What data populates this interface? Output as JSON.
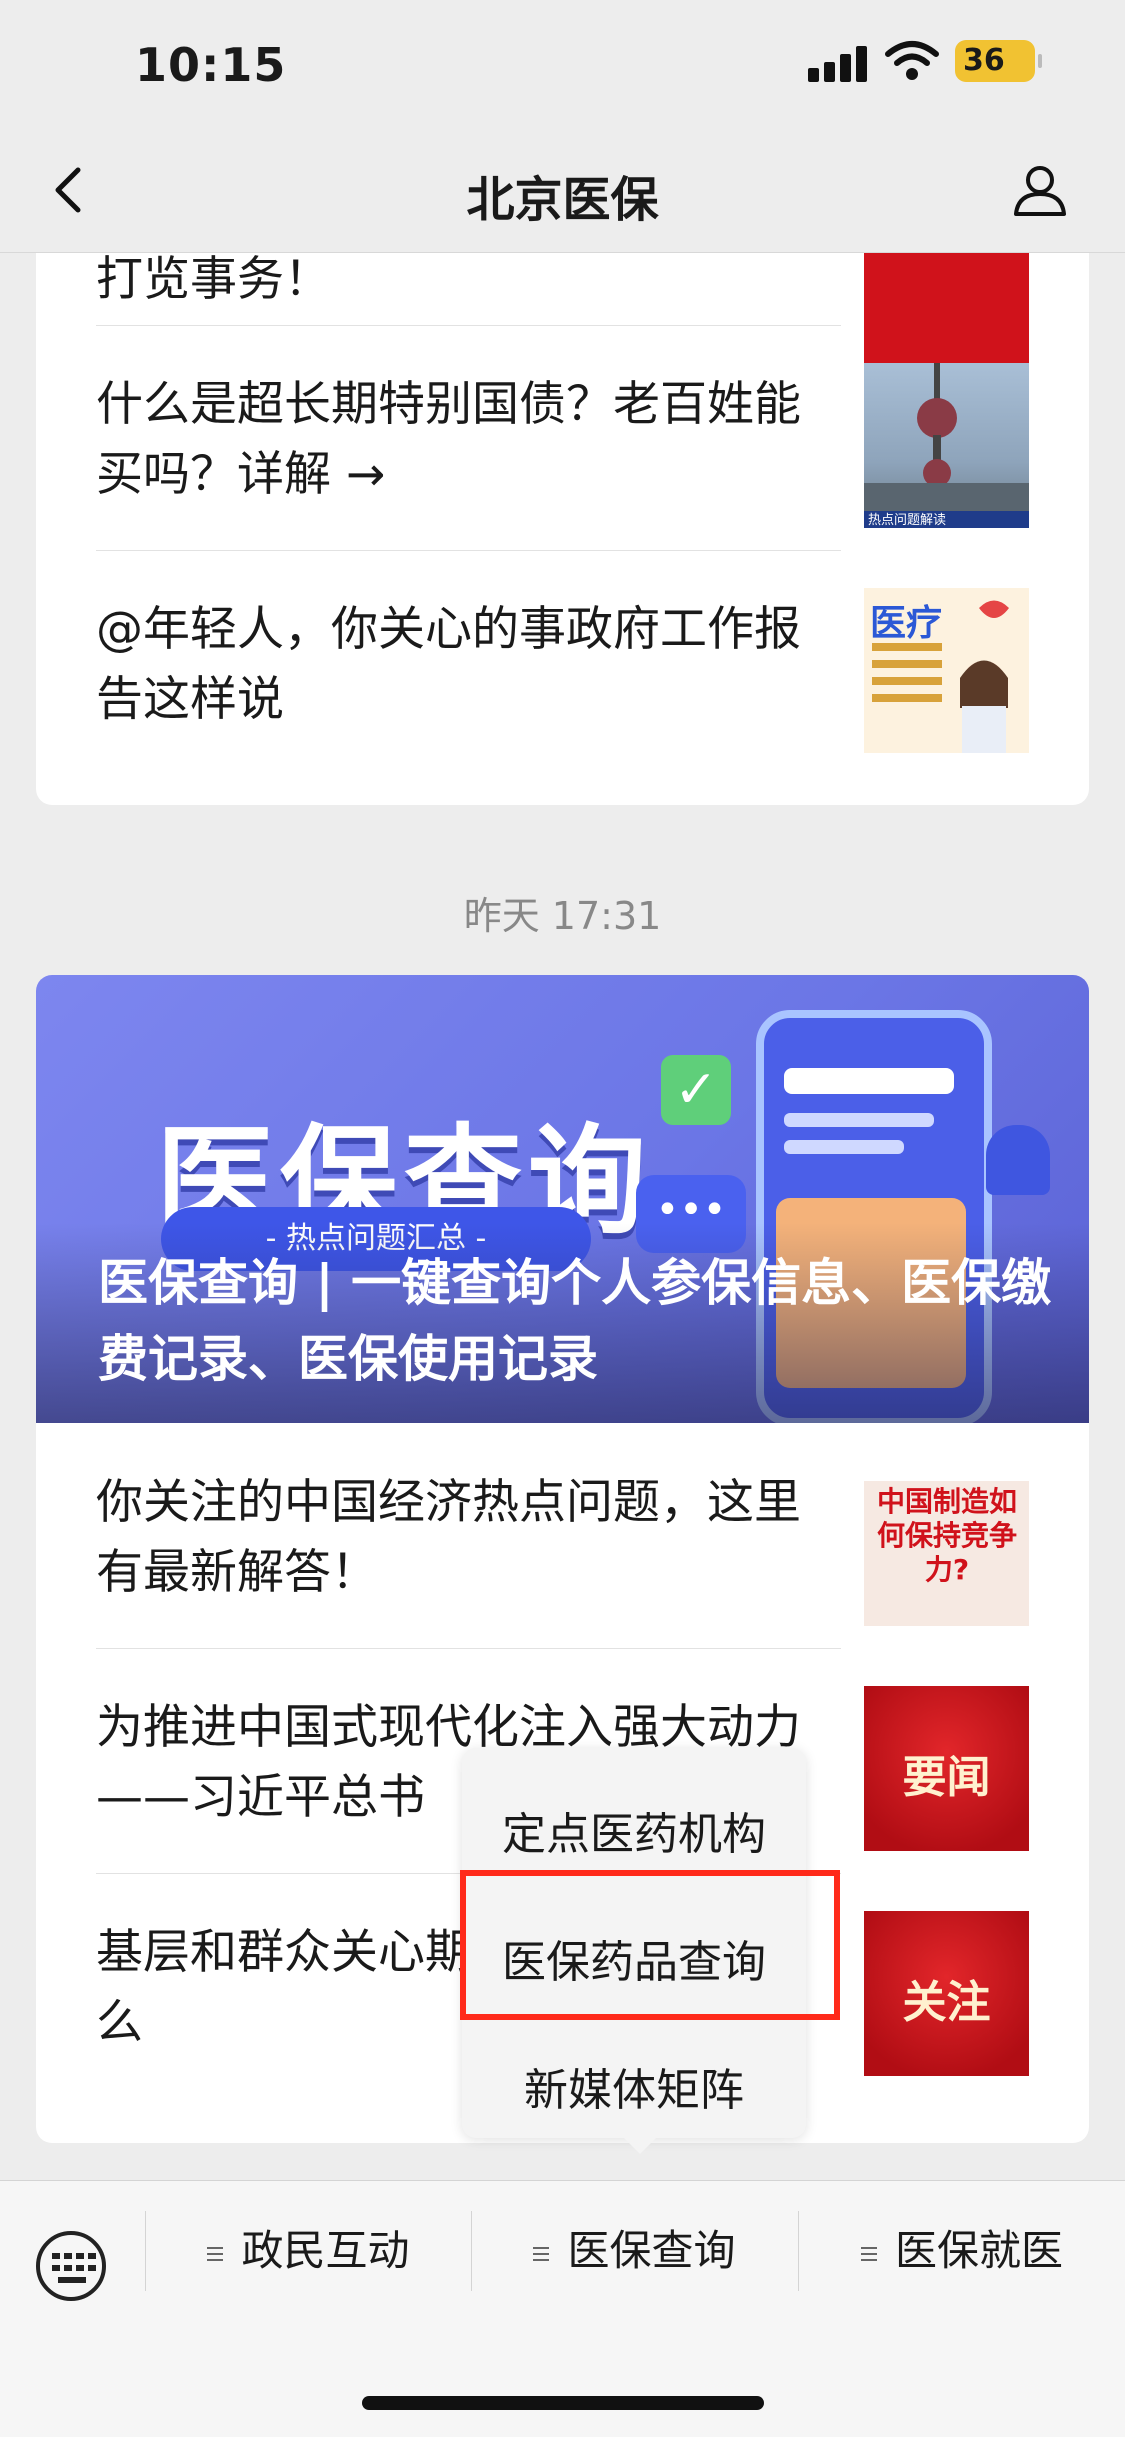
{
  "status_bar": {
    "time": "10:15",
    "battery": "36"
  },
  "nav": {
    "title": "北京医保"
  },
  "top_card": {
    "partial_text": "打览事务！",
    "items": [
      {
        "text": "什么是超长期特别国债？老百姓能买吗？详解 →",
        "thumb_caption": "热点问题解读"
      },
      {
        "text": "@年轻人，你关心的事政府工作报告这样说",
        "thumb_label": "医疗"
      }
    ]
  },
  "timestamp": "昨天 17:31",
  "second_card": {
    "banner": {
      "big_text": "医保查询",
      "pill": "- 热点问题汇总 -",
      "headline": "医保查询 | 一键查询个人参保信息、医保缴费记录、医保使用记录"
    },
    "items": [
      {
        "text": "你关注的中国经济热点问题，这里有最新解答！",
        "thumb_label": "中国制造如何保持竞争力?"
      },
      {
        "text": "为推进中国式现代化注入强大动力——习近平总书",
        "thumb_label": "要闻"
      },
      {
        "text": "基层和群众关心期工作就重点抓什么",
        "thumb_label": "关注"
      }
    ]
  },
  "popup_menu": {
    "options": [
      "定点医药机构",
      "医保药品查询",
      "新媒体矩阵"
    ]
  },
  "bottom_menu": {
    "items": [
      "政民互动",
      "医保查询",
      "医保就医"
    ]
  },
  "colors": {
    "highlight": "#ff2a1a",
    "banner": "#6b76e6",
    "thumb_red": "#d0121b"
  }
}
